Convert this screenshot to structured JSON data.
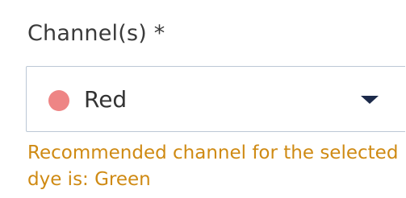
{
  "field": {
    "label": "Channel(s) *",
    "selected_value": "Red",
    "selected_color": "#ee8585",
    "hint_line1": "Recommended channel for the selected",
    "hint_line2": "dye is: Green",
    "hint_color": "#cf8a13",
    "dropdown_icon": "caret-down-icon"
  }
}
